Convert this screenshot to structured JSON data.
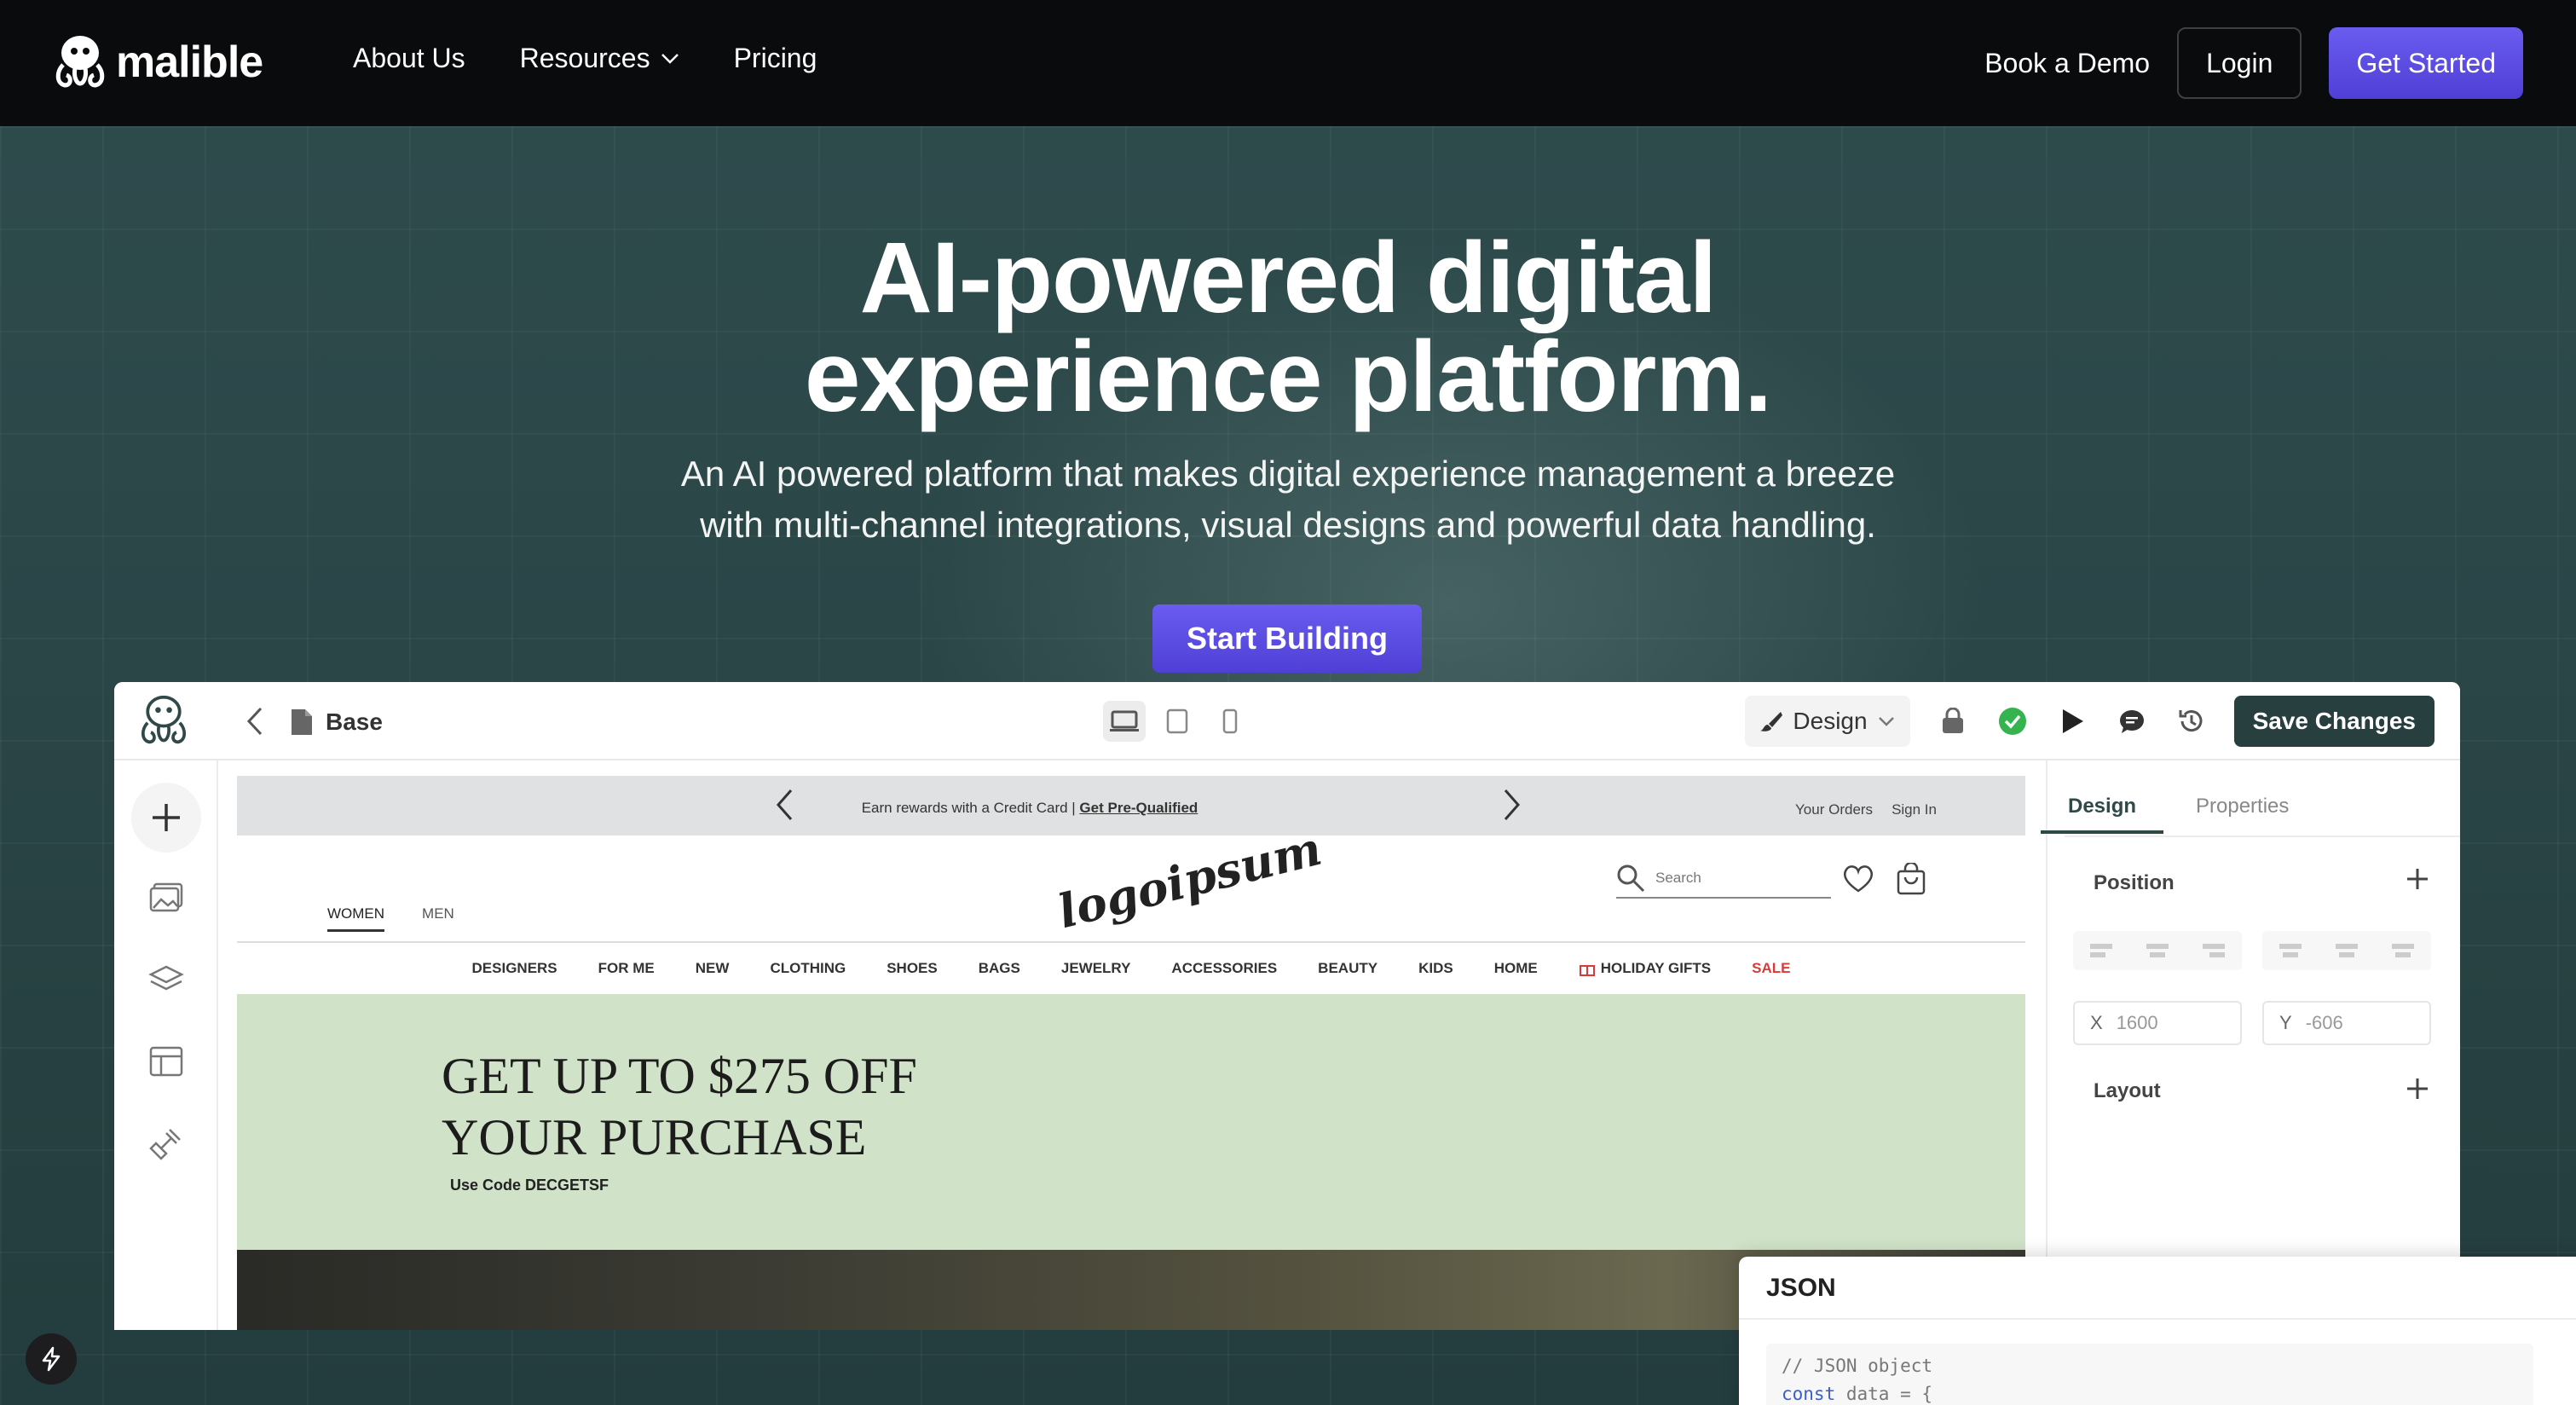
{
  "nav": {
    "brand": "malible",
    "links": [
      "About Us",
      "Resources",
      "Pricing"
    ],
    "book_demo": "Book a Demo",
    "login": "Login",
    "get_started": "Get Started"
  },
  "hero": {
    "title_line1": "AI-powered digital",
    "title_line2": "experience platform.",
    "subtitle_line1": "An AI powered platform that makes digital experience management a breeze",
    "subtitle_line2": "with multi-channel integrations, visual designs and powerful data handling.",
    "cta": "Start Building"
  },
  "editor": {
    "file_name": "Base",
    "mode": "Design",
    "save": "Save Changes",
    "store": {
      "promo_text": "Earn rewards with a Credit Card | ",
      "promo_link": "Get Pre-Qualified",
      "orders": "Your Orders",
      "sign_in": "Sign In",
      "logo": "logoipsum",
      "gender_tabs": [
        "WOMEN",
        "MEN"
      ],
      "search_placeholder": "Search",
      "categories": [
        "DESIGNERS",
        "FOR ME",
        "NEW",
        "CLOTHING",
        "SHOES",
        "BAGS",
        "JEWELRY",
        "ACCESSORIES",
        "BEAUTY",
        "KIDS",
        "HOME"
      ],
      "holiday": "HOLIDAY GIFTS",
      "sale": "SALE",
      "banner_line1": "GET UP TO $275 OFF",
      "banner_line2": "YOUR PURCHASE",
      "banner_code": "Use Code DECGETSF"
    },
    "panel": {
      "tabs": [
        "Design",
        "Properties"
      ],
      "position_label": "Position",
      "x_label": "X",
      "x_value": "1600",
      "y_label": "Y",
      "y_value": "-606",
      "layout_label": "Layout"
    }
  },
  "json_panel": {
    "title": "JSON",
    "line1": "// JSON object",
    "kw": "const",
    "line2_rest": " data = {"
  },
  "colors": {
    "accent": "#5b4de8",
    "hero_bg": "#2e4b4c",
    "save_btn": "#273f3f"
  }
}
